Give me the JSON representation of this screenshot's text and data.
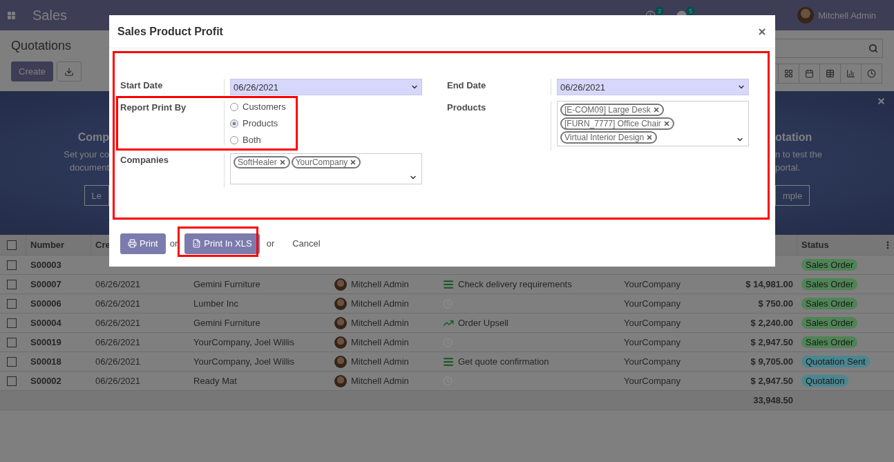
{
  "navbar": {
    "app": "Sales",
    "activity_badge": "2",
    "message_badge": "5",
    "user": "Mitchell Admin"
  },
  "control_panel": {
    "title": "Quotations",
    "create_button": "Create"
  },
  "banner": {
    "left_title": "Comp",
    "left_lines": [
      "Set your co",
      "document"
    ],
    "left_button": "Le",
    "right_title": "otation",
    "right_lines": [
      "n to test the",
      "portal."
    ],
    "right_button": "mple"
  },
  "table": {
    "headers": {
      "number": "Number",
      "date": "Cre",
      "status": "Status"
    },
    "select_all_checked": false,
    "rows": [
      {
        "checked": false,
        "number": "S00003",
        "status": "Sales Order",
        "color": "#4f8455"
      },
      {
        "checked": false,
        "number": "S00007",
        "date": "06/26/2021",
        "customer": "Gemini Furniture",
        "salesperson": "Mitchell Admin",
        "kind": "todo",
        "activity": "Check delivery requirements",
        "company": "YourCompany",
        "total": "$ 14,981.00",
        "status": "Sales Order",
        "color": "#4f8455"
      },
      {
        "checked": false,
        "number": "S00006",
        "date": "06/26/2021",
        "customer": "Lumber Inc",
        "salesperson": "Mitchell Admin",
        "kind": "none",
        "company": "YourCompany",
        "total": "$ 750.00",
        "status": "Sales Order",
        "color": "#4f8455"
      },
      {
        "checked": false,
        "number": "S00004",
        "date": "06/26/2021",
        "customer": "Gemini Furniture",
        "salesperson": "Mitchell Admin",
        "kind": "upsell",
        "activity": "Order Upsell",
        "company": "YourCompany",
        "total": "$ 2,240.00",
        "status": "Sales Order",
        "color": "#4f8455"
      },
      {
        "checked": false,
        "number": "S00019",
        "date": "06/26/2021",
        "customer": "YourCompany, Joel Willis",
        "salesperson": "Mitchell Admin",
        "kind": "none",
        "company": "YourCompany",
        "total": "$ 2,947.50",
        "status": "Sales Order",
        "color": "#4f8455"
      },
      {
        "checked": false,
        "number": "S00018",
        "date": "06/26/2021",
        "customer": "YourCompany, Joel Willis",
        "salesperson": "Mitchell Admin",
        "kind": "todo",
        "activity": "Get quote confirmation",
        "company": "YourCompany",
        "total": "$ 9,705.00",
        "status": "Quotation Sent",
        "color": "#4a8790"
      },
      {
        "checked": false,
        "number": "S00002",
        "date": "06/26/2021",
        "customer": "Ready Mat",
        "salesperson": "Mitchell Admin",
        "kind": "none",
        "company": "YourCompany",
        "total": "$ 2,947.50",
        "status": "Quotation",
        "color": "#4a8790"
      }
    ],
    "footer_total": "33,948.50"
  },
  "dialog": {
    "title": "Sales Product Profit",
    "start_date": {
      "label": "Start Date",
      "value": "06/26/2021"
    },
    "end_date": {
      "label": "End Date",
      "value": "06/26/2021"
    },
    "report_print_by": {
      "label": "Report Print By",
      "options": [
        {
          "label": "Customers",
          "selected": false
        },
        {
          "label": "Products",
          "selected": true
        },
        {
          "label": "Both",
          "selected": false
        }
      ]
    },
    "products": {
      "label": "Products",
      "tags": [
        "[E-COM09] Large Desk",
        "[FURN_7777] Office Chair",
        "Virtual Interior Design"
      ]
    },
    "companies": {
      "label": "Companies",
      "tags": [
        "SoftHealer",
        "YourCompany"
      ]
    },
    "print_button": "Print",
    "or_1": "or",
    "xls_button": "Print In XLS",
    "or_2": "or",
    "cancel": "Cancel"
  }
}
